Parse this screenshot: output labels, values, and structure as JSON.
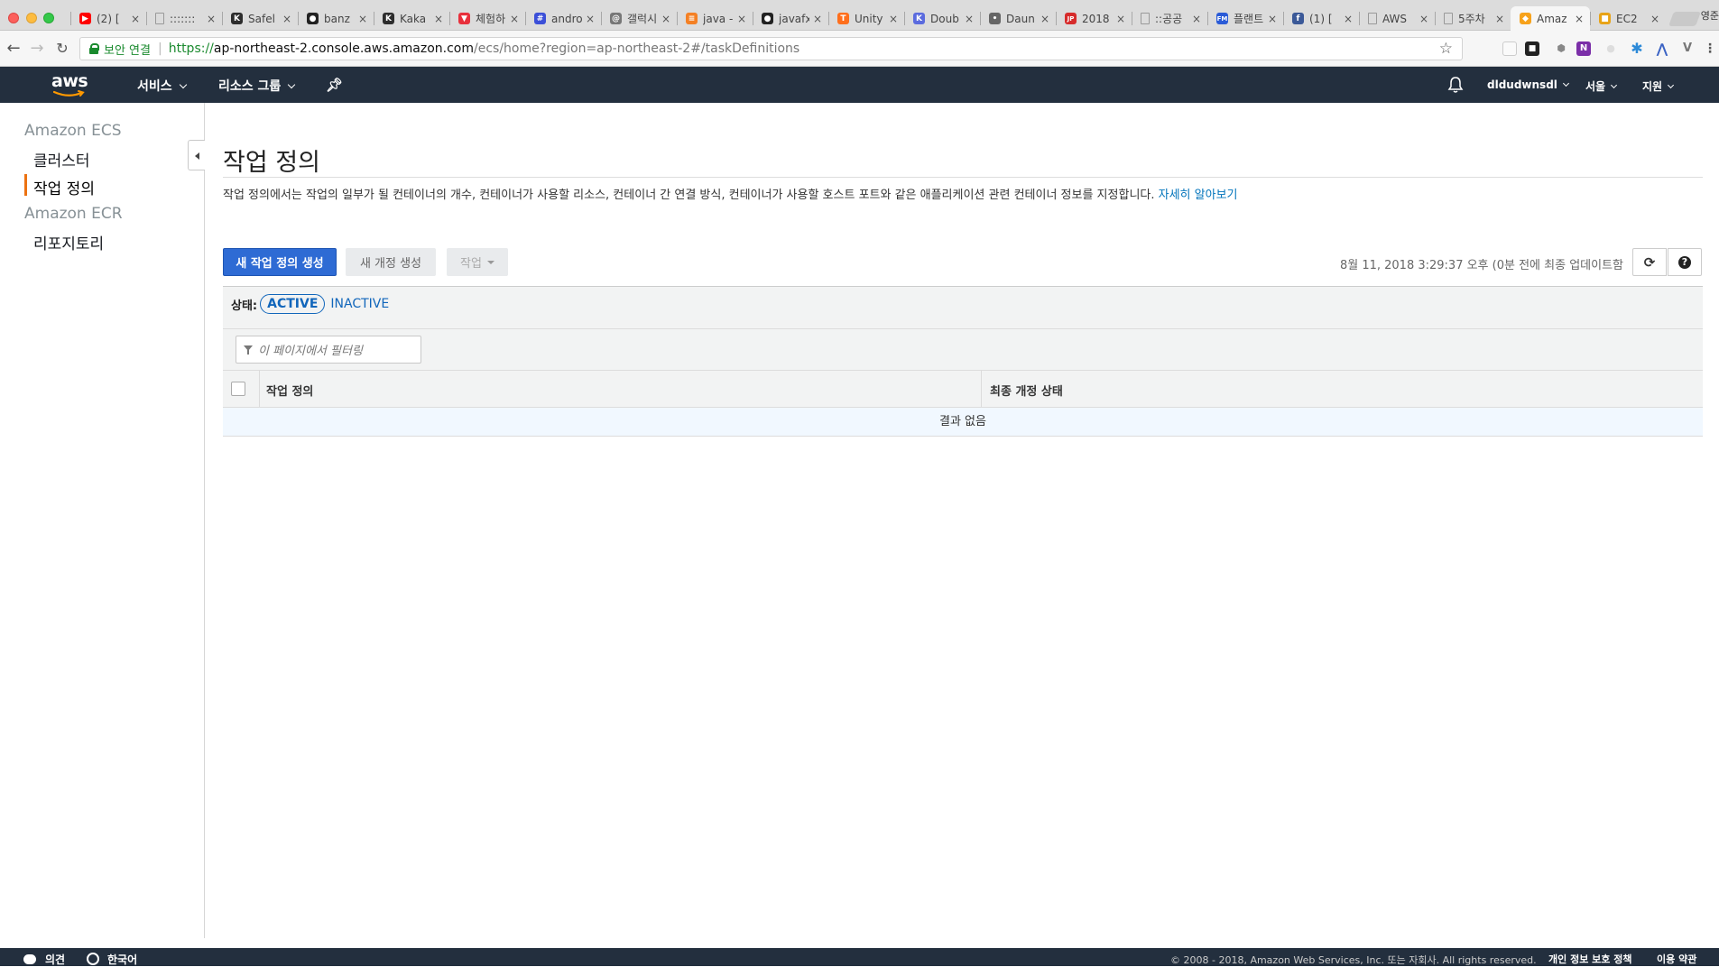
{
  "browser": {
    "tabs": [
      {
        "title": "(2) [",
        "icon": "youtube-icon",
        "color": "#ff0000",
        "glyph": "▶"
      },
      {
        "title": ":::::::",
        "icon": "document-icon",
        "color": "#999999",
        "glyph": ""
      },
      {
        "title": "Safel",
        "icon": "kakao-icon",
        "color": "#2d2d2d",
        "glyph": "K"
      },
      {
        "title": "banz",
        "icon": "github-icon",
        "color": "#222222",
        "glyph": "●"
      },
      {
        "title": "Kaka",
        "icon": "kakao-icon",
        "color": "#2d2d2d",
        "glyph": "K"
      },
      {
        "title": "체험하",
        "icon": "app-icon",
        "color": "#e8303c",
        "glyph": "▼"
      },
      {
        "title": "andro",
        "icon": "hash-icon",
        "color": "#3b4fd8",
        "glyph": "#"
      },
      {
        "title": "갤럭시",
        "icon": "fingerprint-icon",
        "color": "#777777",
        "glyph": "@"
      },
      {
        "title": "java -",
        "icon": "stackoverflow-icon",
        "color": "#f48024",
        "glyph": "≡"
      },
      {
        "title": "javafx",
        "icon": "github-icon",
        "color": "#222222",
        "glyph": "●"
      },
      {
        "title": "Unity",
        "icon": "unity-icon",
        "color": "#ff6f1c",
        "glyph": "T"
      },
      {
        "title": "Doub",
        "icon": "kotlin-icon",
        "color": "#5b6bde",
        "glyph": "K"
      },
      {
        "title": "Daun",
        "icon": "map-pin-icon",
        "color": "#666666",
        "glyph": "•"
      },
      {
        "title": "2018",
        "icon": "jobplanet-icon",
        "color": "#d62b2b",
        "glyph": "JP"
      },
      {
        "title": "::공공",
        "icon": "document-icon",
        "color": "#999999",
        "glyph": ""
      },
      {
        "title": "플랜트",
        "icon": "fm-icon",
        "color": "#2a5bd7",
        "glyph": "FM"
      },
      {
        "title": "(1) [",
        "icon": "facebook-icon",
        "color": "#3b5998",
        "glyph": "f"
      },
      {
        "title": "AWS",
        "icon": "document-icon",
        "color": "#999999",
        "glyph": ""
      },
      {
        "title": "5주차",
        "icon": "document-icon",
        "color": "#999999",
        "glyph": ""
      },
      {
        "title": "Amaz",
        "icon": "aws-icon",
        "color": "#f7a21b",
        "glyph": "◆",
        "active": true
      },
      {
        "title": "EC2",
        "icon": "aws-box-icon",
        "color": "#e8a317",
        "glyph": "■"
      }
    ],
    "profile_name": "영준",
    "secure_label": "보안 연결",
    "url_scheme": "https://",
    "url_host": "ap-northeast-2.console.aws.amazon.com",
    "url_path": "/ecs/home?region=ap-northeast-2#/taskDefinitions"
  },
  "aws_nav": {
    "logo": "aws",
    "services": "서비스",
    "resource_groups": "리소스 그룹",
    "username": "dldudwnsdl",
    "region": "서울",
    "support": "지원"
  },
  "sidebar": {
    "ecs_heading": "Amazon ECS",
    "ecs_items": [
      "클러스터",
      "작업 정의"
    ],
    "ecr_heading": "Amazon ECR",
    "ecr_items": [
      "리포지토리"
    ],
    "active_item": "작업 정의",
    "accent_color": "#ec7211"
  },
  "main": {
    "title": "작업 정의",
    "description": "작업 정의에서는 작업의 일부가 될 컨테이너의 개수, 컨테이너가 사용할 리소스, 컨테이너 간 연결 방식, 컨테이너가 사용할 호스트 포트와 같은 애플리케이션 관련 컨테이너 정보를 지정합니다.",
    "learn_more": "자세히 알아보기",
    "create_button": "새 작업 정의 생성",
    "create_revision_button": "새 개정 생성",
    "actions_button": "작업",
    "last_updated": "8월 11, 2018 3:29:37 오후 (0분 전에 최종 업데이트함",
    "status_label": "상태:",
    "status_active": "ACTIVE",
    "status_inactive": "INACTIVE",
    "filter_placeholder": "이 페이지에서 필터링",
    "columns": [
      "작업 정의",
      "최종 개정 상태"
    ],
    "empty_text": "결과 없음",
    "primary_color": "#2e6bd4"
  },
  "footer": {
    "feedback": "의견",
    "language": "한국어",
    "copyright": "© 2008 - 2018, Amazon Web Services, Inc. 또는 자회사. All rights reserved.",
    "privacy": "개인 정보 보호 정책",
    "terms": "이용 약관"
  }
}
